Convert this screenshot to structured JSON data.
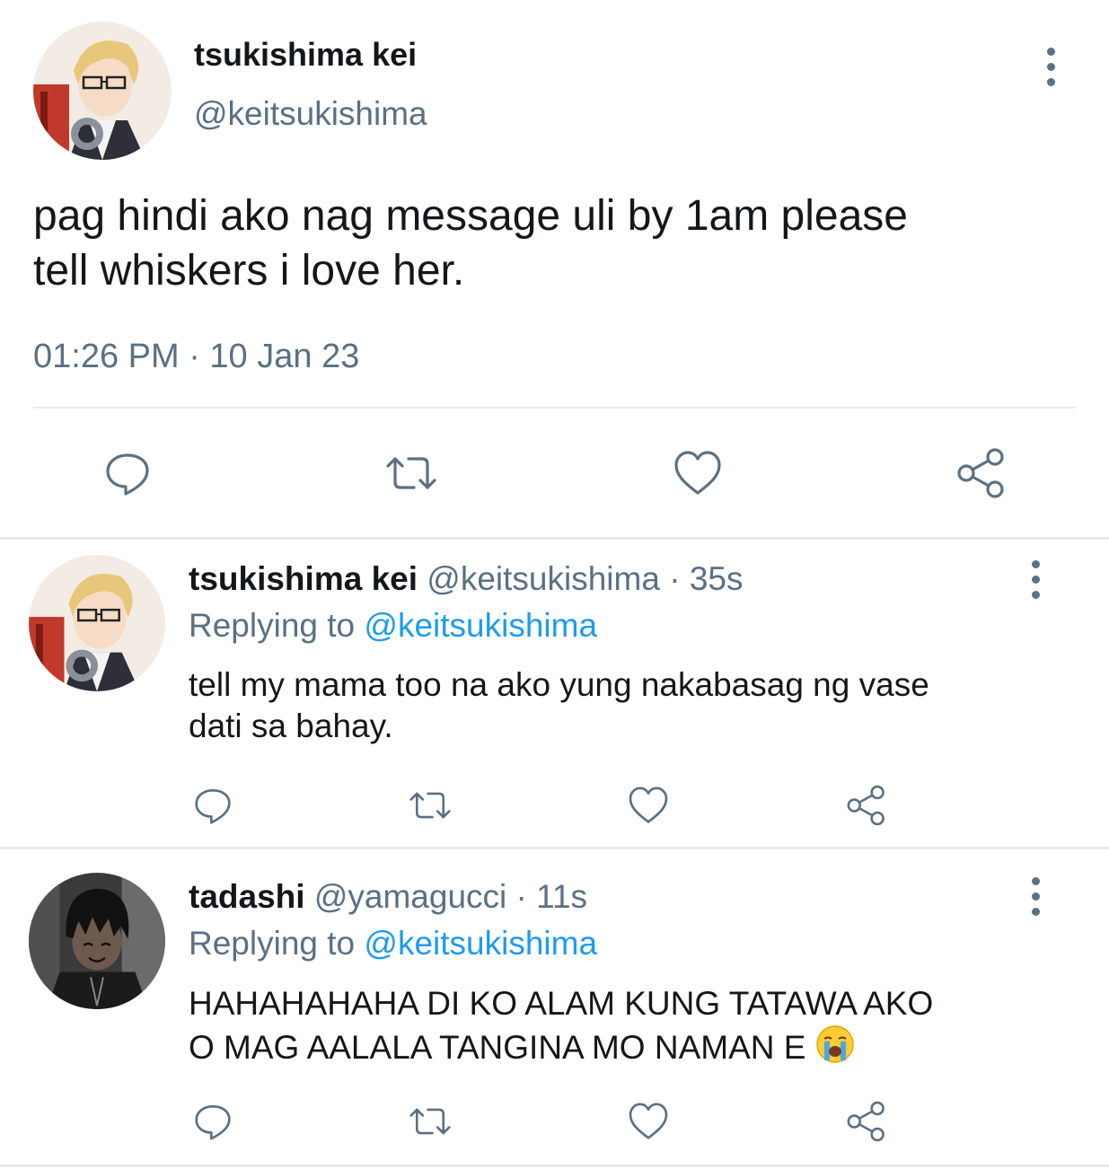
{
  "main_tweet": {
    "display_name": "tsukishima kei",
    "handle": "@keitsukishima",
    "text_line1": "pag hindi ako nag message uli by 1am please",
    "text_line2": "tell whiskers i love her.",
    "timestamp": "01:26 PM · 10 Jan 23",
    "avatar": "tsukishima-avatar"
  },
  "replies": [
    {
      "display_name": "tsukishima kei",
      "handle": "@keitsukishima",
      "time": "· 35s",
      "replying_prefix": "Replying to",
      "replying_handle": "@keitsukishima",
      "text_line1": "tell my mama too na ako yung nakabasag ng vase",
      "text_line2": "dati sa bahay.",
      "avatar": "tsukishima-avatar"
    },
    {
      "display_name": "tadashi",
      "handle": "@yamagucci",
      "time": "· 11s",
      "replying_prefix": "Replying to",
      "replying_handle": "@keitsukishima",
      "text_line1": "HAHAHAHAHA DI KO ALAM KUNG TATAWA AKO",
      "text_line2": "O MAG AALALA TANGINA MO NAMAN E",
      "emoji": "loudly-crying-face-emoji",
      "avatar": "tadashi-avatar"
    }
  ],
  "icons": [
    "reply-icon",
    "retweet-icon",
    "like-icon",
    "share-icon",
    "more-options-icon"
  ],
  "colors": {
    "text": "#14171a",
    "muted": "#5b7083",
    "link": "#1d9bf0",
    "divider": "#e6ecf0"
  }
}
